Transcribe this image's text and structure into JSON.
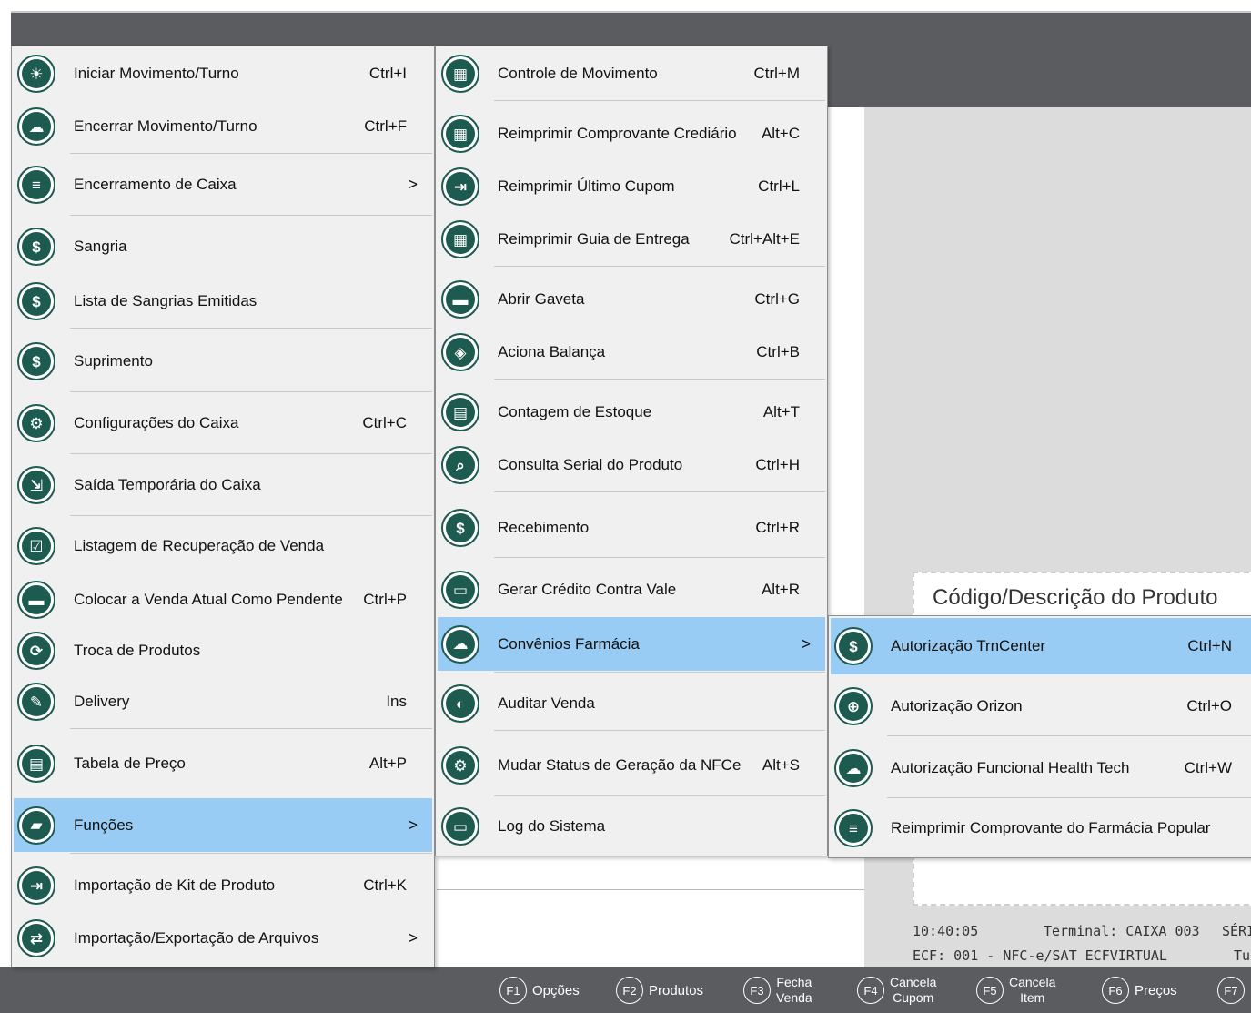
{
  "colors": {
    "icon": "#1d5a50",
    "selected": "#99ccf4",
    "bar": "#5b5c60",
    "menu_bg": "#f0f0f0"
  },
  "main_menu": [
    {
      "label": "Iniciar Movimento/Turno",
      "shortcut": "Ctrl+I",
      "icon": "sun-icon",
      "glyph": "☀"
    },
    {
      "label": "Encerrar Movimento/Turno",
      "shortcut": "Ctrl+F",
      "icon": "cloud-sun-icon",
      "glyph": "☁"
    },
    {
      "label": "Encerramento de Caixa",
      "shortcut": ">",
      "icon": "list-icon",
      "glyph": "≡"
    },
    {
      "label": "Sangria",
      "shortcut": "",
      "icon": "money-minus-icon",
      "glyph": "$"
    },
    {
      "label": "Lista de Sangrias Emitidas",
      "shortcut": "",
      "icon": "money-minus-icon",
      "glyph": "$"
    },
    {
      "label": "Suprimento",
      "shortcut": "",
      "icon": "money-plus-icon",
      "glyph": "$"
    },
    {
      "label": "Configurações do Caixa",
      "shortcut": "Ctrl+C",
      "icon": "gears-icon",
      "glyph": "⚙"
    },
    {
      "label": "Saída Temporária do Caixa",
      "shortcut": "",
      "icon": "exit-icon",
      "glyph": "⇲"
    },
    {
      "label": "Listagem de Recuperação de Venda",
      "shortcut": "",
      "icon": "checklist-icon",
      "glyph": "☑"
    },
    {
      "label": "Colocar a Venda Atual Como Pendente",
      "shortcut": "Ctrl+P",
      "icon": "register-icon",
      "glyph": "▬"
    },
    {
      "label": "Troca  de Produtos",
      "shortcut": "",
      "icon": "exchange-icon",
      "glyph": "⟳"
    },
    {
      "label": "Delivery",
      "shortcut": "Ins",
      "icon": "delivery-icon",
      "glyph": "✎"
    },
    {
      "label": "Tabela de Preço",
      "shortcut": "Alt+P",
      "icon": "clipboard-icon",
      "glyph": "▤"
    },
    {
      "label": "Funções",
      "shortcut": ">",
      "icon": "folder-icon",
      "glyph": "▰"
    },
    {
      "label": "Importação de Kit de Produto",
      "shortcut": "Ctrl+K",
      "icon": "import-icon",
      "glyph": "⇥"
    },
    {
      "label": "Importação/Exportação de Arquivos",
      "shortcut": ">",
      "icon": "shuffle-icon",
      "glyph": "⇄"
    }
  ],
  "sub_menu": [
    {
      "label": "Controle de Movimento",
      "shortcut": "Ctrl+M",
      "icon": "calculator-icon",
      "glyph": "▦"
    },
    {
      "label": "Reimprimir Comprovante Crediário",
      "shortcut": "Alt+C",
      "icon": "calculator-icon",
      "glyph": "▦"
    },
    {
      "label": "Reimprimir Último Cupom",
      "shortcut": "Ctrl+L",
      "icon": "import-icon",
      "glyph": "⇥"
    },
    {
      "label": "Reimprimir Guia de Entrega",
      "shortcut": "Ctrl+Alt+E",
      "icon": "calculator-icon",
      "glyph": "▦"
    },
    {
      "label": "Abrir Gaveta",
      "shortcut": "Ctrl+G",
      "icon": "drawer-icon",
      "glyph": "▬"
    },
    {
      "label": "Aciona Balança",
      "shortcut": "Ctrl+B",
      "icon": "layers-icon",
      "glyph": "◈"
    },
    {
      "label": "Contagem de Estoque",
      "shortcut": "Alt+T",
      "icon": "clipboard-icon",
      "glyph": "▤"
    },
    {
      "label": "Consulta Serial do Produto",
      "shortcut": "Ctrl+H",
      "icon": "search-icon",
      "glyph": "⌕"
    },
    {
      "label": "Recebimento",
      "shortcut": "Ctrl+R",
      "icon": "money-plus-icon",
      "glyph": "$"
    },
    {
      "label": "Gerar Crédito Contra Vale",
      "shortcut": "Alt+R",
      "icon": "hand-card-icon",
      "glyph": "▭"
    },
    {
      "label": "Convênios Farmácia",
      "shortcut": ">",
      "icon": "cloud-upload-icon",
      "glyph": "☁"
    },
    {
      "label": "Auditar Venda",
      "shortcut": "",
      "icon": "audit-icon",
      "glyph": "◐"
    },
    {
      "label": "Mudar Status de Geração da NFCe",
      "shortcut": "Alt+S",
      "icon": "gears-icon",
      "glyph": "⚙"
    },
    {
      "label": "Log do Sistema",
      "shortcut": "",
      "icon": "hand-card-icon",
      "glyph": "▭"
    }
  ],
  "sub_sub_menu": [
    {
      "label": "Autorização TrnCenter",
      "shortcut": "Ctrl+N",
      "icon": "money-check-icon",
      "glyph": "$"
    },
    {
      "label": "Autorização Orizon",
      "shortcut": "Ctrl+O",
      "icon": "plus-circle-icon",
      "glyph": "⊕"
    },
    {
      "label": "Autorização Funcional Health Tech",
      "shortcut": "Ctrl+W",
      "icon": "cloud-upload-icon",
      "glyph": "☁"
    },
    {
      "label": "Reimprimir Comprovante do Farmácia Popular",
      "shortcut": "",
      "icon": "list-icon",
      "glyph": "≡"
    }
  ],
  "product_label": "Código/Descrição do Produto",
  "status": {
    "time": "10:40:05",
    "terminal": "Terminal: CAIXA 003",
    "serie": "SÉRIE",
    "ecf": "ECF: 001 - NFC-e/SAT ECFVIRTUAL",
    "turno": "Turno"
  },
  "fkeys": [
    {
      "key": "F1",
      "label": "Opções",
      "label2": ""
    },
    {
      "key": "F2",
      "label": "Produtos",
      "label2": ""
    },
    {
      "key": "F3",
      "label": "Fecha",
      "label2": "Venda"
    },
    {
      "key": "F4",
      "label": "Cancela",
      "label2": "Cupom"
    },
    {
      "key": "F5",
      "label": "Cancela",
      "label2": "Item"
    },
    {
      "key": "F6",
      "label": "Preços",
      "label2": ""
    },
    {
      "key": "F7",
      "label": "",
      "label2": ""
    }
  ]
}
